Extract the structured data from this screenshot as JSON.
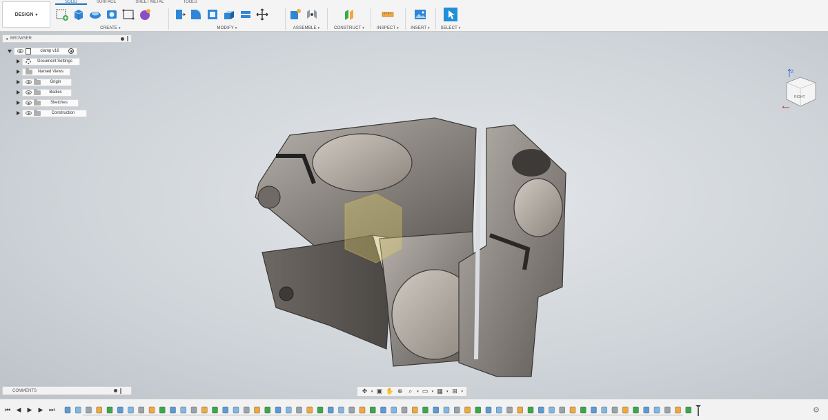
{
  "workspace": {
    "label": "DESIGN"
  },
  "tabs": [
    {
      "label": "SOLID",
      "active": true
    },
    {
      "label": "SURFACE",
      "active": false
    },
    {
      "label": "SHEET METAL",
      "active": false
    },
    {
      "label": "TOOLS",
      "active": false
    }
  ],
  "groups": {
    "create": "CREATE",
    "modify": "MODIFY",
    "assemble": "ASSEMBLE",
    "construct": "CONSTRUCT",
    "inspect": "INSPECT",
    "insert": "INSERT",
    "select": "SELECT"
  },
  "browser": {
    "title": "BROWSER",
    "root": "clamp v16",
    "items": [
      {
        "label": "Document Settings",
        "icon": "gear-icon"
      },
      {
        "label": "Named Views",
        "icon": "folder-icon"
      },
      {
        "label": "Origin",
        "icon": "folder-icon"
      },
      {
        "label": "Bodies",
        "icon": "folder-icon"
      },
      {
        "label": "Sketches",
        "icon": "folder-icon"
      },
      {
        "label": "Construction",
        "icon": "folder-icon"
      }
    ]
  },
  "comments": {
    "title": "COMMENTS"
  },
  "viewcube": {
    "face": "RIGHT",
    "axis": "Z"
  },
  "colors": {
    "accent": "#1e6fb8",
    "toolbar_bg": "#f4f4f4",
    "model_metal": "#8a8580"
  }
}
